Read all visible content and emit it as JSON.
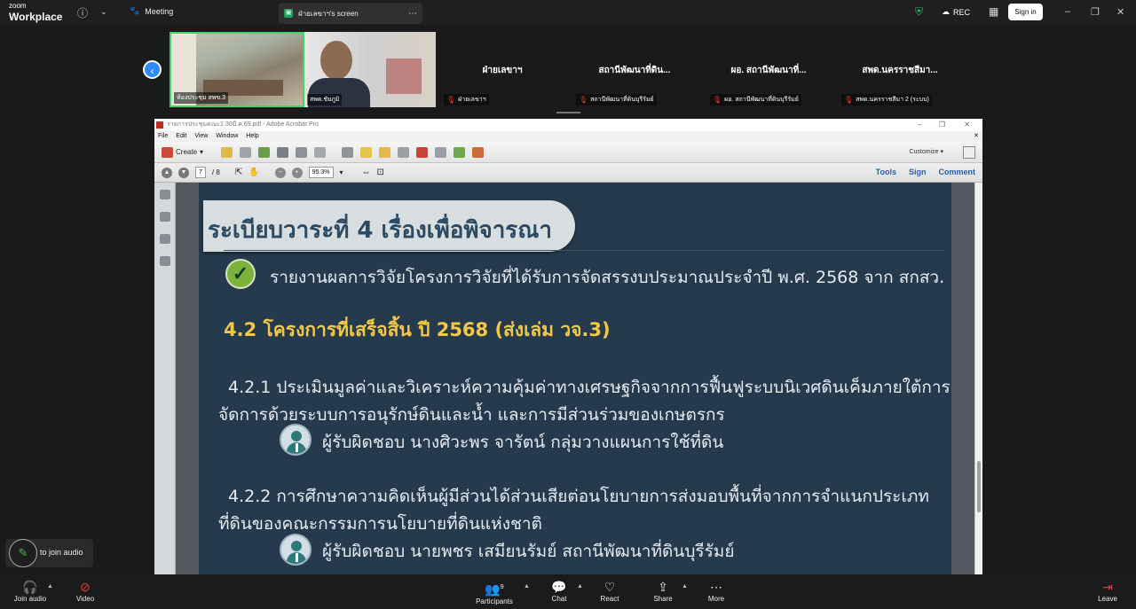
{
  "app": {
    "logo_small": "zoom",
    "logo_big": "Workplace",
    "meeting_label": "Meeting",
    "screen_tab": "ฝ่ายเลขาฯ's screen",
    "rec_label": "REC",
    "signin_label": "Sign in"
  },
  "gallery": {
    "video1_label": "ห้องประชุม สพข.3",
    "video2_label": "สพด.ชัยภูมิ",
    "tiles": [
      {
        "name": "ฝ่ายเลขาฯ",
        "sub": "ฝ่ายเลขาฯ"
      },
      {
        "name": "สถานีพัฒนาที่ดิน...",
        "sub": "สถานีพัฒนาที่ดินบุรีรัมย์"
      },
      {
        "name": "ผอ. สถานีพัฒนาที่...",
        "sub": "ผอ. สถานีพัฒนาที่ดินบุรีรัมย์"
      },
      {
        "name": "สพด.นครราชสีมา...",
        "sub": "สพด.นครราชสีมา 2 (ระบบ)"
      }
    ]
  },
  "acrobat": {
    "title": "รายการประชุมคณะ1 30มี.ค.69.pdf - Adobe Acrobat Pro",
    "menu": [
      "File",
      "Edit",
      "View",
      "Window",
      "Help"
    ],
    "create_label": "Create",
    "customize_label": "Customize",
    "page_current": "7",
    "page_total": "/ 8",
    "zoom": "95.3%",
    "right_tabs": [
      "Tools",
      "Sign",
      "Comment"
    ]
  },
  "slide": {
    "heading": "ระเบียบวาระที่ 4   เรื่องเพื่อพิจารณา",
    "check_text": "รายงานผลการวิจัยโครงการวิจัยที่ได้รับการจัดสรรงบประมาณประจำปี พ.ศ. 2568 จาก สกสว.",
    "subhead": "4.2 โครงการที่เสร็จสิ้น ปี 2568 (ส่งเล่ม วจ.3)",
    "item1_line1": "4.2.1 ประเมินมูลค่าและวิเคราะห์ความคุ้มค่าทางเศรษฐกิจจากการฟื้นฟูระบบนิเวศดินเค็มภายใต้การ",
    "item1_line2": "จัดการด้วยระบบการอนุรักษ์ดินและน้ำ และการมีส่วนร่วมของเกษตรกร",
    "item1_resp": "ผู้รับผิดชอบ นางศิวะพร จารัตน์  กลุ่มวางแผนการใช้ที่ดิน",
    "item2_line1": "4.2.2 การศึกษาความคิดเห็นผู้มีส่วนได้ส่วนเสียต่อนโยบายการส่งมอบพื้นที่จากการจำแนกประเภท",
    "item2_line2": "ที่ดินของคณะกรรมการนโยบายที่ดินแห่งชาติ",
    "item2_resp": "ผู้รับผิดชอบ นายพชร เสมียนรัมย์  สถานีพัฒนาที่ดินบุรีรัมย์"
  },
  "audio_bubble": "to join audio",
  "toolbar": {
    "join_audio": "Join audio",
    "video": "Video",
    "participants": "Participants",
    "participants_count": "9",
    "chat": "Chat",
    "react": "React",
    "share": "Share",
    "more": "More",
    "leave": "Leave"
  }
}
